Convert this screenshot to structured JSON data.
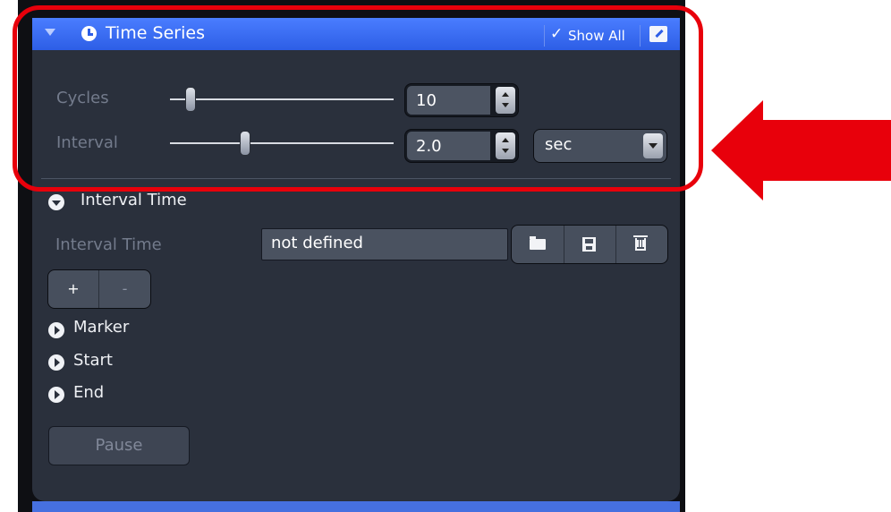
{
  "panel": {
    "title": "Time Series",
    "show_all_check": "✓",
    "show_all_label": "Show All"
  },
  "cycles": {
    "label": "Cycles",
    "value": "10",
    "slider_level": 0.15
  },
  "interval": {
    "label": "Interval",
    "value": "2.0",
    "unit": "sec",
    "slider_level": 0.33
  },
  "interval_time_section": {
    "header": "Interval Time",
    "field_label": "Interval Time",
    "field_value": "not defined"
  },
  "plus_minus": {
    "plus": "+",
    "minus": "-"
  },
  "sections": [
    "Marker",
    "Start",
    "End"
  ],
  "pause_label": "Pause",
  "colors": {
    "accent": "#2d5ee6",
    "panel": "#2a303c",
    "highlight": "#e8000b"
  }
}
